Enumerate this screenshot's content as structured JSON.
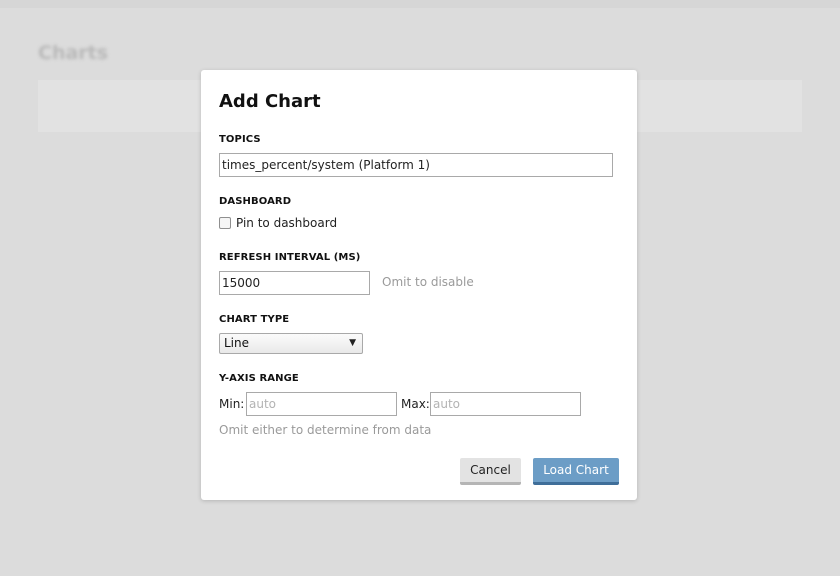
{
  "background": {
    "page_title": "Charts"
  },
  "modal": {
    "title": "Add Chart",
    "topics": {
      "label": "TOPICS",
      "value": "times_percent/system (Platform 1)"
    },
    "dashboard": {
      "label": "DASHBOARD",
      "checkbox_label": "Pin to dashboard",
      "checked": false
    },
    "refresh_interval": {
      "label": "REFRESH INTERVAL (MS)",
      "value": "15000",
      "hint": "Omit to disable"
    },
    "chart_type": {
      "label": "CHART TYPE",
      "selected": "Line"
    },
    "y_axis_range": {
      "label": "Y-AXIS RANGE",
      "min_label": "Min:",
      "min_placeholder": "auto",
      "max_label": "Max:",
      "max_placeholder": "auto",
      "hint": "Omit either to determine from data"
    },
    "buttons": {
      "cancel": "Cancel",
      "load": "Load Chart"
    }
  },
  "colors": {
    "overlay_background": "#dcdcdc",
    "primary_button": "#6c9dc6",
    "hint_text": "#9a9a9a"
  },
  "icons": {
    "select_arrow": "chevron-down-icon"
  }
}
